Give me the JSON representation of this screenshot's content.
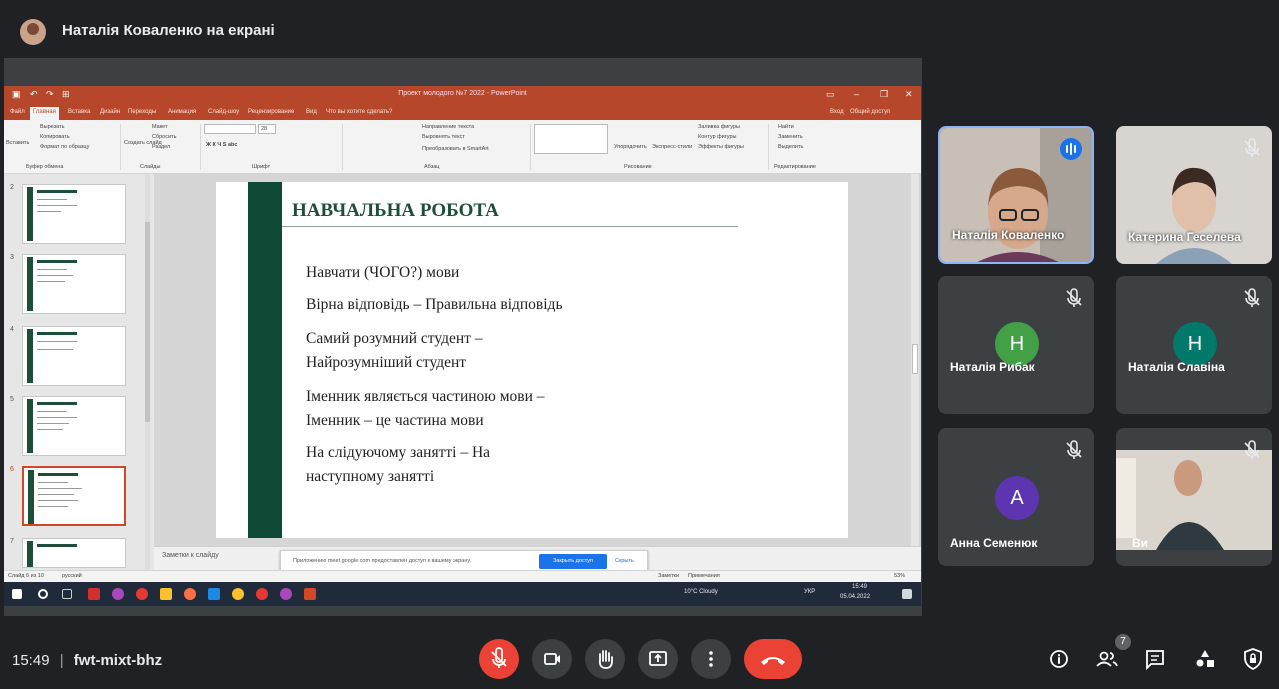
{
  "header": {
    "presenter_title": "Наталія Коваленко на екрані"
  },
  "powerpoint": {
    "window_title": "Проект молодого №7 2022 - PowerPoint",
    "tabs": [
      "Файл",
      "Главная",
      "Вставка",
      "Дизайн",
      "Переходы",
      "Анимация",
      "Слайд-шоу",
      "Рецензирование",
      "Вид",
      "Что вы хотите сделать?"
    ],
    "active_tab": "Главная",
    "signin": "Вход",
    "share": "Общий доступ",
    "ribbon": {
      "paste": "Вставить",
      "cut": "Вырезать",
      "copy": "Копировать",
      "format_painter": "Формат по образцу",
      "clipboard_group": "Буфер обмена",
      "new_slide": "Создать слайд",
      "layout": "Макет",
      "reset": "Сбросить",
      "section": "Раздел",
      "slides_group": "Слайды",
      "font_size": "28",
      "font_group": "Шрифт",
      "text_direction": "Направление текста",
      "align_text": "Выровнять текст",
      "convert_smartart": "Преобразовать в SmartArt",
      "paragraph_group": "Абзац",
      "arrange": "Упорядочить",
      "quick_styles": "Экспресс-стили",
      "shape_fill": "Заливка фигуры",
      "shape_outline": "Контур фигуры",
      "shape_effects": "Эффекты фигуры",
      "drawing_group": "Рисование",
      "find": "Найти",
      "replace": "Заменить",
      "select": "Выделить",
      "editing_group": "Редактирование"
    },
    "thumbnails": [
      {
        "num": "2"
      },
      {
        "num": "3"
      },
      {
        "num": "4"
      },
      {
        "num": "5"
      },
      {
        "num": "6"
      },
      {
        "num": "7"
      }
    ],
    "slide": {
      "title": "НАВЧАЛЬНА РОБОТА",
      "lines": [
        "Навчати (ЧОГО?) мови",
        "Вірна відповідь – Правильна відповідь",
        "Самий розумний студент –",
        "Найрозумніший студент",
        "Іменник являється частиною мови –",
        "Іменник – це частина мови",
        "На слідуючому занятті – На",
        "наступному занятті"
      ]
    },
    "notes_placeholder": "Заметки к слайду",
    "share_banner": {
      "message": "Приложению meet.google.com предоставлен доступ к вашему экрану.",
      "stop_button": "Закрыть доступ",
      "hide_link": "Скрыть"
    },
    "status": {
      "slide_counter": "Слайд 6 из 10",
      "language": "русский",
      "notes": "Заметки",
      "comments": "Примечания",
      "zoom": "53%"
    },
    "taskbar": {
      "weather": "10°C Cloudy",
      "lang": "УКР",
      "time": "15:49",
      "date": "05.04.2022"
    }
  },
  "participants": [
    {
      "name": "Наталія Коваленко",
      "display": "Наталія Коваленко",
      "speaking": true
    },
    {
      "name": "Катерина Геселева",
      "display": "Катерина Геселева",
      "muted": true
    },
    {
      "name": "Наталія Рибак",
      "letter": "Н",
      "color": "#43a047",
      "muted": true
    },
    {
      "name": "Наталія Славіна",
      "letter": "Н",
      "color": "#00796b",
      "muted": true
    },
    {
      "name": "Анна Семенюк",
      "letter": "А",
      "color": "#5e35b1",
      "muted": true
    },
    {
      "name": "Ви",
      "muted": true
    }
  ],
  "meeting": {
    "time": "15:49",
    "code": "fwt-mixt-bhz",
    "participant_count": "7"
  },
  "colors": {
    "background": "#202124",
    "tile": "#3c4043",
    "danger": "#ea4335",
    "accent": "#8ab4f8",
    "ppt_brand": "#b7472a",
    "slide_green": "#0f4a37"
  }
}
